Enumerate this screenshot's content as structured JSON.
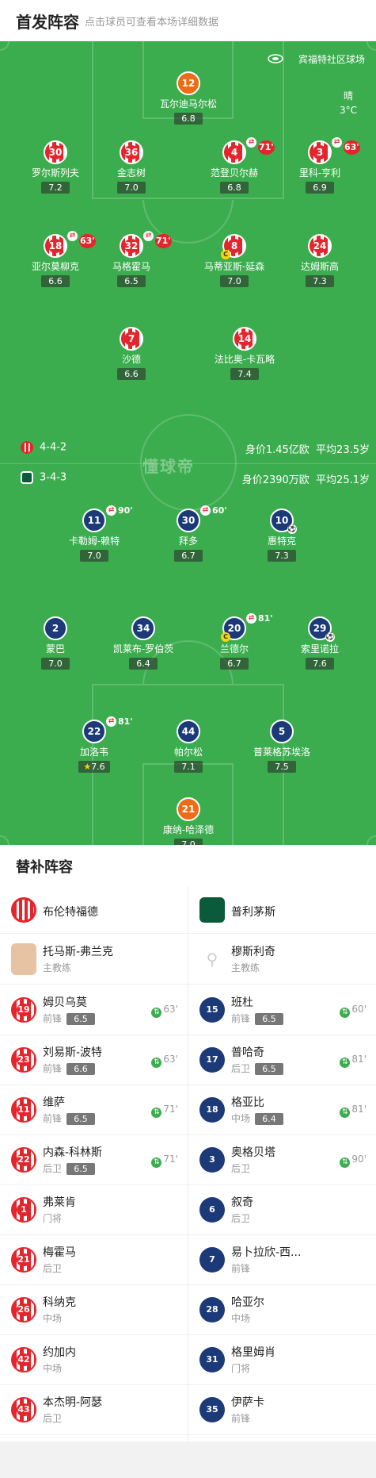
{
  "header": {
    "title": "首发阵容",
    "hint": "点击球员可查看本场详细数据"
  },
  "venue": "宾福特社区球场",
  "weather": {
    "cond": "晴",
    "temp": "3°C"
  },
  "watermark": "懂球帝",
  "home": {
    "formation": "4-4-2",
    "value": "身价1.45亿欧",
    "age": "平均23.5岁"
  },
  "away": {
    "formation": "3-4-3",
    "value": "身价2390万欧",
    "age": "平均25.1岁"
  },
  "players": [
    {
      "num": "12",
      "name": "瓦尔迪马尔松",
      "rating": "6.8",
      "kit": "gk1"
    },
    {
      "num": "30",
      "name": "罗尔斯列夫",
      "rating": "7.2",
      "kit": "out"
    },
    {
      "num": "36",
      "name": "金志树",
      "rating": "7.0",
      "kit": "out"
    },
    {
      "num": "4",
      "name": "范登贝尔赫",
      "rating": "6.8",
      "kit": "out",
      "sub": "71'"
    },
    {
      "num": "3",
      "name": "里科-亨利",
      "rating": "6.9",
      "kit": "out",
      "sub": "63'"
    },
    {
      "num": "18",
      "name": "亚尔莫柳克",
      "rating": "6.6",
      "kit": "out",
      "sub": "63'"
    },
    {
      "num": "32",
      "name": "马格霍马",
      "rating": "6.5",
      "kit": "out",
      "sub": "71'"
    },
    {
      "num": "8",
      "name": "马蒂亚斯-延森",
      "rating": "7.0",
      "kit": "out",
      "cap": "C"
    },
    {
      "num": "24",
      "name": "达姆斯高",
      "rating": "7.3",
      "kit": "out"
    },
    {
      "num": "7",
      "name": "沙德",
      "rating": "6.6",
      "kit": "out"
    },
    {
      "num": "14",
      "name": "法比奥-卡瓦略",
      "rating": "7.4",
      "kit": "out"
    },
    {
      "num": "11",
      "name": "卡勒姆-赖特",
      "rating": "7.0",
      "kit": "ply",
      "sub": "90'"
    },
    {
      "num": "30",
      "name": "拜多",
      "rating": "6.7",
      "kit": "ply",
      "sub": "60'"
    },
    {
      "num": "10",
      "name": "惠特克",
      "rating": "7.3",
      "kit": "ply",
      "ball": "⚽"
    },
    {
      "num": "2",
      "name": "蒙巴",
      "rating": "7.0",
      "kit": "ply"
    },
    {
      "num": "34",
      "name": "凯莱布-罗伯茨",
      "rating": "6.4",
      "kit": "ply"
    },
    {
      "num": "20",
      "name": "兰德尔",
      "rating": "6.7",
      "kit": "ply",
      "sub": "81'",
      "cap": "C"
    },
    {
      "num": "29",
      "name": "索里诺拉",
      "rating": "7.6",
      "kit": "ply",
      "ball": "⚽"
    },
    {
      "num": "22",
      "name": "加洛韦",
      "rating": "7.6",
      "kit": "ply",
      "sub": "81'",
      "star": "★"
    },
    {
      "num": "44",
      "name": "帕尔松",
      "rating": "7.1",
      "kit": "ply"
    },
    {
      "num": "5",
      "name": "普莱格苏埃洛",
      "rating": "7.5",
      "kit": "ply"
    },
    {
      "num": "21",
      "name": "康纳-哈泽德",
      "rating": "7.0",
      "kit": "gk1"
    }
  ],
  "bench": {
    "title": "替补阵容",
    "home_team": "布伦特福德",
    "away_team": "普利茅斯",
    "home_coach": {
      "name": "托马斯-弗兰克",
      "role": "主教练"
    },
    "away_coach": {
      "name": "穆斯利奇",
      "role": "主教练"
    },
    "home_subs": [
      {
        "num": "19",
        "name": "姆贝乌莫",
        "pos": "前锋",
        "rating": "6.5",
        "time": "63'"
      },
      {
        "num": "23",
        "name": "刘易斯-波特",
        "pos": "前锋",
        "rating": "6.6",
        "time": "63'"
      },
      {
        "num": "11",
        "name": "维萨",
        "pos": "前锋",
        "rating": "6.5",
        "time": "71'"
      },
      {
        "num": "22",
        "name": "内森-科林斯",
        "pos": "后卫",
        "rating": "6.5",
        "time": "71'"
      },
      {
        "num": "1",
        "name": "弗莱肯",
        "pos": "门将"
      },
      {
        "num": "21",
        "name": "梅霍马",
        "pos": "后卫"
      },
      {
        "num": "26",
        "name": "科纳克",
        "pos": "中场"
      },
      {
        "num": "42",
        "name": "约加内",
        "pos": "中场"
      },
      {
        "num": "43",
        "name": "本杰明-阿瑟",
        "pos": "后卫"
      }
    ],
    "away_subs": [
      {
        "num": "15",
        "name": "班杜",
        "pos": "前锋",
        "rating": "6.5",
        "time": "60'"
      },
      {
        "num": "17",
        "name": "普哈奇",
        "pos": "后卫",
        "rating": "6.5",
        "time": "81'"
      },
      {
        "num": "18",
        "name": "格亚比",
        "pos": "中场",
        "rating": "6.4",
        "time": "81'"
      },
      {
        "num": "3",
        "name": "奥格贝塔",
        "pos": "后卫",
        "time": "90'"
      },
      {
        "num": "6",
        "name": "叙奇",
        "pos": "后卫"
      },
      {
        "num": "7",
        "name": "易卜拉欣-西...",
        "pos": "前锋"
      },
      {
        "num": "28",
        "name": "哈亚尔",
        "pos": "中场"
      },
      {
        "num": "31",
        "name": "格里姆肖",
        "pos": "门将"
      },
      {
        "num": "35",
        "name": "伊萨卡",
        "pos": "前锋"
      }
    ]
  }
}
